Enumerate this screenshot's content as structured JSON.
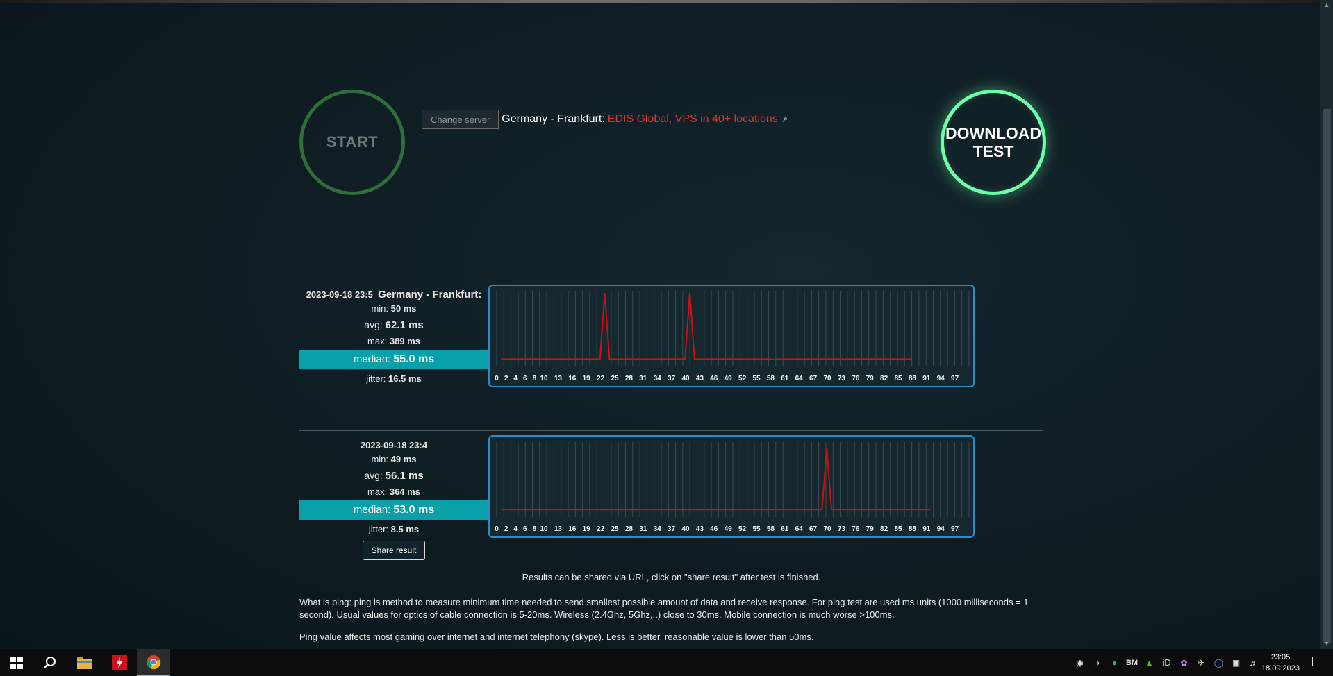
{
  "controls": {
    "start_label": "START",
    "download_line1": "DOWNLOAD",
    "download_line2": "TEST",
    "change_server_label": "Change server",
    "server_name": "Germany - Frankfurt:",
    "server_link_text": "EDIS Global, VPS in 40+ locations"
  },
  "results": [
    {
      "timestamp": "2023-09-18 23:5",
      "location": "Germany - Frankfurt:",
      "min_label": "min:",
      "min_value": "50 ms",
      "avg_label": "avg:",
      "avg_value": "62.1 ms",
      "max_label": "max:",
      "max_value": "389 ms",
      "median_label": "median:",
      "median_value": "55.0 ms",
      "jitter_label": "jitter:",
      "jitter_value": "16.5 ms"
    },
    {
      "timestamp": "2023-09-18 23:4",
      "location": "",
      "min_label": "min:",
      "min_value": "49 ms",
      "avg_label": "avg:",
      "avg_value": "56.1 ms",
      "max_label": "max:",
      "max_value": "364 ms",
      "median_label": "median:",
      "median_value": "53.0 ms",
      "jitter_label": "jitter:",
      "jitter_value": "8.5 ms",
      "share_label": "Share result"
    }
  ],
  "chart_data": [
    {
      "type": "line",
      "x_ticks": [
        "0",
        "2",
        "4",
        "6",
        "8",
        "10",
        "13",
        "16",
        "19",
        "22",
        "25",
        "28",
        "31",
        "34",
        "37",
        "40",
        "43",
        "46",
        "49",
        "52",
        "55",
        "58",
        "61",
        "64",
        "67",
        "70",
        "73",
        "76",
        "79",
        "82",
        "85",
        "88",
        "91",
        "94",
        "97"
      ],
      "x": [
        0,
        1,
        2,
        3,
        4,
        5,
        6,
        7,
        8,
        9,
        10,
        11,
        12,
        13,
        14,
        15,
        16,
        17,
        18,
        19,
        20,
        21,
        22,
        23,
        24,
        25,
        26,
        27,
        28,
        29,
        30,
        31,
        32,
        33,
        34,
        35,
        36,
        37,
        38,
        39,
        40,
        41,
        42,
        43,
        44,
        45,
        46,
        47,
        48,
        49,
        50,
        51,
        52,
        53,
        54,
        55,
        56,
        57,
        58,
        59,
        60,
        61,
        62,
        63,
        64,
        65,
        66,
        67,
        68,
        69,
        70,
        71,
        72,
        73,
        74,
        75,
        76,
        77,
        78,
        79,
        80,
        81,
        82,
        83,
        84,
        85,
        86,
        87
      ],
      "values": [
        52,
        52,
        52,
        52,
        52,
        52,
        52,
        52,
        52,
        52,
        52,
        52,
        52,
        52,
        52,
        52,
        52,
        52,
        52,
        52,
        52,
        52,
        389,
        52,
        52,
        52,
        52,
        52,
        52,
        52,
        52,
        52,
        52,
        52,
        52,
        52,
        52,
        52,
        52,
        52,
        389,
        52,
        52,
        52,
        52,
        52,
        52,
        52,
        52,
        52,
        52,
        52,
        52,
        52,
        52,
        52,
        52,
        52,
        50,
        52,
        52,
        52,
        52,
        52,
        52,
        52,
        52,
        52,
        52,
        52,
        52,
        52,
        52,
        52,
        52,
        52,
        52,
        52,
        52,
        52,
        52,
        52,
        52,
        52,
        52,
        52,
        52,
        52
      ],
      "line_color": "#cc1111"
    },
    {
      "type": "line",
      "x_ticks": [
        "0",
        "2",
        "4",
        "6",
        "8",
        "10",
        "13",
        "16",
        "19",
        "22",
        "25",
        "28",
        "31",
        "34",
        "37",
        "40",
        "43",
        "46",
        "49",
        "52",
        "55",
        "58",
        "61",
        "64",
        "67",
        "70",
        "73",
        "76",
        "79",
        "82",
        "85",
        "88",
        "91",
        "94",
        "97"
      ],
      "x": [
        0,
        1,
        2,
        3,
        4,
        5,
        6,
        7,
        8,
        9,
        10,
        11,
        12,
        13,
        14,
        15,
        16,
        17,
        18,
        19,
        20,
        21,
        22,
        23,
        24,
        25,
        26,
        27,
        28,
        29,
        30,
        31,
        32,
        33,
        34,
        35,
        36,
        37,
        38,
        39,
        40,
        41,
        42,
        43,
        44,
        45,
        46,
        47,
        48,
        49,
        50,
        51,
        52,
        53,
        54,
        55,
        56,
        57,
        58,
        59,
        60,
        61,
        62,
        63,
        64,
        65,
        66,
        67,
        68,
        69,
        70,
        71,
        72,
        73,
        74,
        75,
        76,
        77,
        78,
        79,
        80,
        81,
        82,
        83,
        84,
        85,
        86,
        87,
        88,
        89,
        90,
        91
      ],
      "values": [
        53,
        53,
        53,
        53,
        53,
        53,
        53,
        53,
        53,
        53,
        53,
        53,
        53,
        53,
        53,
        53,
        53,
        53,
        53,
        53,
        53,
        53,
        53,
        53,
        53,
        53,
        53,
        53,
        53,
        53,
        53,
        53,
        53,
        53,
        53,
        53,
        53,
        53,
        53,
        53,
        53,
        53,
        53,
        53,
        53,
        53,
        53,
        53,
        53,
        52,
        53,
        53,
        53,
        53,
        53,
        53,
        53,
        53,
        53,
        53,
        53,
        53,
        53,
        53,
        53,
        53,
        53,
        53,
        53,
        364,
        53,
        53,
        53,
        53,
        53,
        53,
        53,
        53,
        53,
        53,
        53,
        53,
        53,
        53,
        53,
        53,
        53,
        53,
        53,
        53,
        53,
        53
      ],
      "line_color": "#cc1111"
    }
  ],
  "info": {
    "notice": "Results can be shared via URL, click on \"share result\" after test is finished.",
    "para1": "What is ping: ping is method to measure minimum time needed to send smallest possible amount of data and receive response. For ping test are used ms units (1000 milliseconds = 1 second). Usual values for optics of cable connection is 5-20ms. Wireless (2.4Ghz, 5Ghz,..) close to 30ms. Mobile connection is much worse >100ms.",
    "para2": "Ping value affects most gaming over internet and internet telephony (skype). Less is better, reasonable value is lower than 50ms."
  },
  "taskbar": {
    "tray_labels": [
      "BM",
      "iD"
    ],
    "time": "23:05",
    "date": "18.09.2023"
  }
}
